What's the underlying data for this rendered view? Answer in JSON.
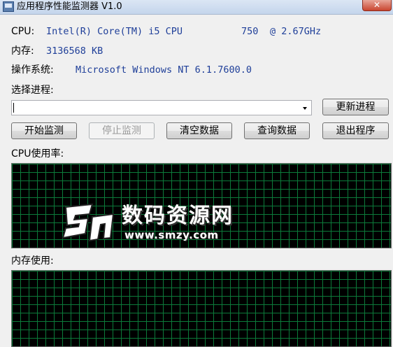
{
  "window": {
    "title": "应用程序性能监测器 V1.0",
    "close_glyph": "✕"
  },
  "info": {
    "cpu_label": "CPU:",
    "cpu_name": "Intel(R) Core(TM) i5 CPU",
    "cpu_mhz": "750",
    "cpu_freq": "@ 2.67GHz",
    "mem_label": "内存:",
    "mem_value": "3136568 KB",
    "os_label": "操作系统:",
    "os_value": "Microsoft Windows NT 6.1.7600.0"
  },
  "process": {
    "label": "选择进程:",
    "selected": "",
    "refresh_label": "更新进程"
  },
  "toolbar": {
    "start_label": "开始监测",
    "stop_label": "停止监测",
    "clear_label": "清空数据",
    "query_label": "查询数据",
    "exit_label": "退出程序"
  },
  "graphs": {
    "cpu_label": "CPU使用率:",
    "mem_label": "内存使用:"
  },
  "watermark": {
    "text_cn": "数码资源网",
    "url": "www.smzy.com"
  },
  "colors": {
    "grid_line": "#0c7a3a",
    "graph_bg": "#000000",
    "info_value": "#1f3f99"
  }
}
